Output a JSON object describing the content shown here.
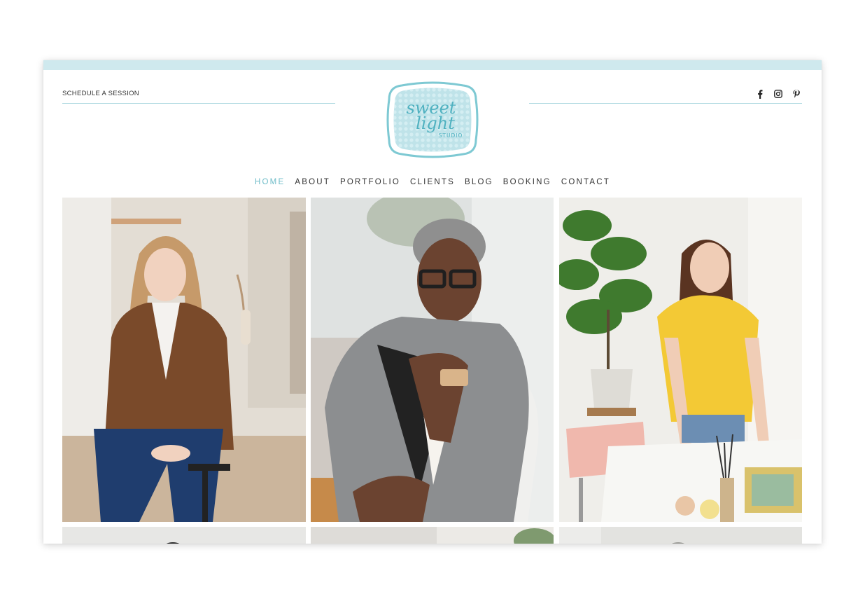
{
  "header": {
    "schedule_link": "SCHEDULE A SESSION",
    "social_icons": [
      "facebook-icon",
      "instagram-icon",
      "pinterest-icon"
    ]
  },
  "logo": {
    "line1": "sweet",
    "line2": "light",
    "line3": "STUDIO",
    "colors": {
      "frame": "#7ec9d3",
      "fill": "#bfe3e9",
      "text": "#4fb1c0"
    }
  },
  "nav": {
    "items": [
      {
        "label": "HOME",
        "active": true
      },
      {
        "label": "ABOUT",
        "active": false
      },
      {
        "label": "PORTFOLIO",
        "active": false
      },
      {
        "label": "CLIENTS",
        "active": false
      },
      {
        "label": "BLOG",
        "active": false
      },
      {
        "label": "BOOKING",
        "active": false
      },
      {
        "label": "CONTACT",
        "active": false
      }
    ]
  },
  "colors": {
    "accent": "#6fbcc8",
    "top_bar": "#cfe9ee",
    "divider": "#a9d6de",
    "text": "#333333"
  }
}
